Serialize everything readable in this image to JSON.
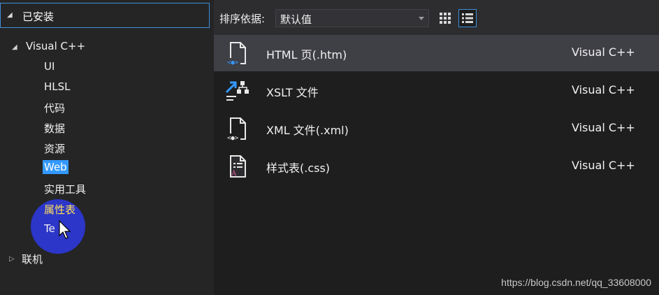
{
  "left_panel": {
    "header": {
      "label": "已安装"
    },
    "tree": {
      "root": {
        "label": "Visual C++"
      },
      "children": [
        {
          "label": "UI"
        },
        {
          "label": "HLSL"
        },
        {
          "label": "代码"
        },
        {
          "label": "数据"
        },
        {
          "label": "资源"
        },
        {
          "label": "Web"
        },
        {
          "label": "实用工具"
        },
        {
          "label": "属性表"
        },
        {
          "label": "Te"
        }
      ],
      "online": {
        "label": "联机"
      }
    }
  },
  "toolbar": {
    "sort_label": "排序依据:",
    "sort_value": "默认值"
  },
  "templates": [
    {
      "name": "HTML 页(.htm)",
      "language": "Visual C++",
      "icon": "html-file-icon"
    },
    {
      "name": "XSLT 文件",
      "language": "Visual C++",
      "icon": "xslt-file-icon"
    },
    {
      "name": "XML 文件(.xml)",
      "language": "Visual C++",
      "icon": "xml-file-icon"
    },
    {
      "name": "样式表(.css)",
      "language": "Visual C++",
      "icon": "css-file-icon"
    }
  ],
  "watermark": "https://blog.csdn.net/qq_33608000",
  "colors": {
    "selection": "#3399ff",
    "accent_border": "#3e8fd8",
    "hover_text": "#ffe25a",
    "cursor_highlight": "#2d37d6"
  }
}
